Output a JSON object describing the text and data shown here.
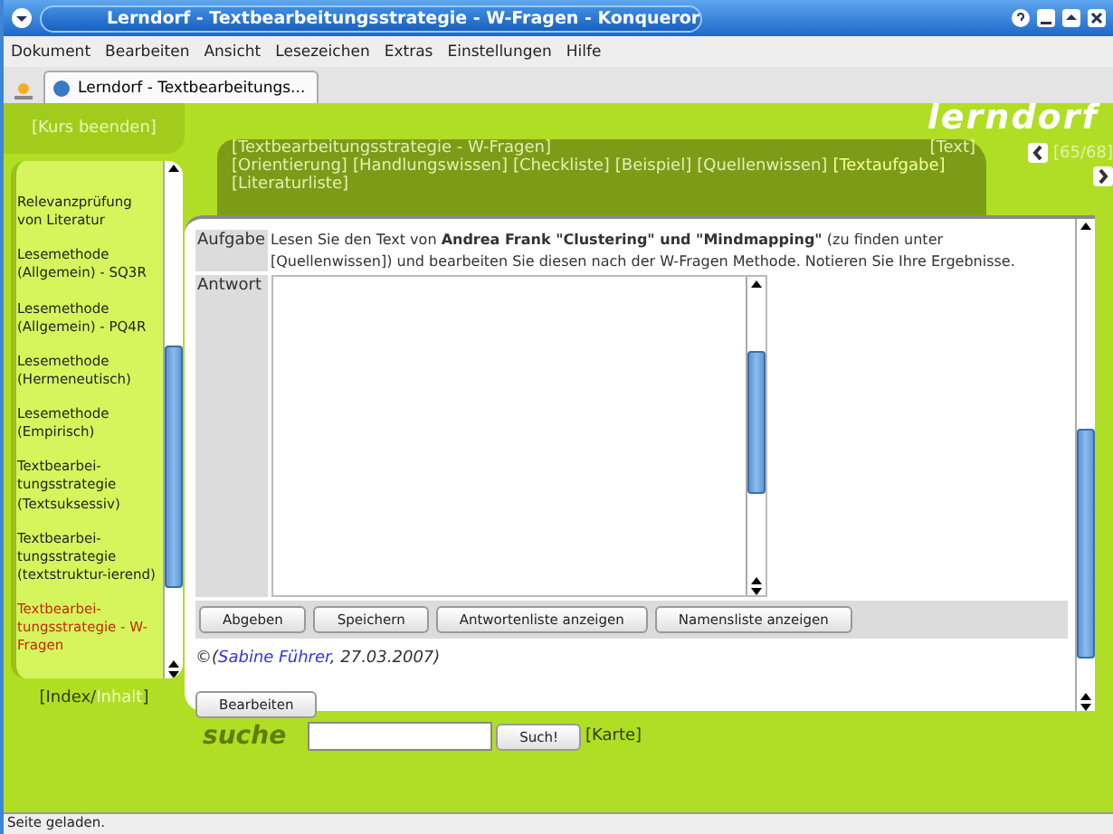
{
  "window": {
    "title": "Lerndorf - Textbearbeitungsstrategie - W-Fragen - Konqueror"
  },
  "menu": [
    {
      "label": "Dokument"
    },
    {
      "label": "Bearbeiten"
    },
    {
      "label": "Ansicht"
    },
    {
      "label": "Lesezeichen"
    },
    {
      "label": "Extras"
    },
    {
      "label": "Einstellungen"
    },
    {
      "label": "Hilfe"
    }
  ],
  "browser_tabs": [
    {
      "label": "Lerndorf - Textbearbeitungs...",
      "selected": true
    }
  ],
  "page": {
    "exit_link": "[Kurs beenden]",
    "logo": "lerndorf",
    "sidebar": {
      "items": [
        {
          "label": "Relevanzprüfung von Literatur",
          "selected": false
        },
        {
          "label": "Lesemethode (Allgemein) - SQ3R",
          "selected": false
        },
        {
          "label": "Lesemethode (Allgemein) - PQ4R",
          "selected": false
        },
        {
          "label": "Lesemethode (Hermeneutisch)",
          "selected": false
        },
        {
          "label": "Lesemethode (Empirisch)",
          "selected": false
        },
        {
          "label": "Textbearbei-tungsstrategie (Textsuksessiv)",
          "selected": false
        },
        {
          "label": "Textbearbei-tungsstrategie (textstruktur-ierend)",
          "selected": false
        },
        {
          "label": "Textbearbei-tungsstrategie - W-Fragen",
          "selected": true
        }
      ],
      "footer_links": [
        {
          "label": "[Index/",
          "selected": false
        },
        {
          "label": "Inhalt",
          "selected": true
        },
        {
          "label": "]",
          "selected": false
        }
      ]
    },
    "breadcrumb": "[Textbearbeitungsstrategie - W-Fragen]",
    "text_link": "[Text]",
    "counter": "[65/68]",
    "sections": [
      {
        "label": "[Orientierung]",
        "selected": false
      },
      {
        "label": "[Handlungswissen]",
        "selected": false
      },
      {
        "label": "[Checkliste]",
        "selected": false
      },
      {
        "label": "[Beispiel]",
        "selected": false
      },
      {
        "label": "[Quellenwissen]",
        "selected": false
      },
      {
        "label": "[Textaufgabe]",
        "selected": true
      },
      {
        "label": "[Literaturliste]",
        "selected": false
      }
    ],
    "task": {
      "label": "Aufgabe",
      "text": "Lesen Sie den Text von **Andrea Frank \"Clustering\" und \"Mindmapping\"** (zu finden unter [Quellenwissen]) und bearbeiten Sie diesen nach der W-Fragen Methode. Notieren Sie Ihre Ergebnisse."
    },
    "answer": {
      "label": "Antwort"
    },
    "buttons": [
      "Abgeben",
      "Speichern",
      "Antwortenliste anzeigen",
      "Namensliste anzeigen"
    ],
    "copyright": {
      "open": "©(",
      "author": "Sabine Führer",
      "date": ", 27.03.2007",
      "close": ")"
    },
    "edit_button": "Bearbeiten",
    "search": {
      "logo": "suche",
      "button": "Such!",
      "map_link": "[Karte]"
    }
  },
  "status_bar": "Seite geladen."
}
